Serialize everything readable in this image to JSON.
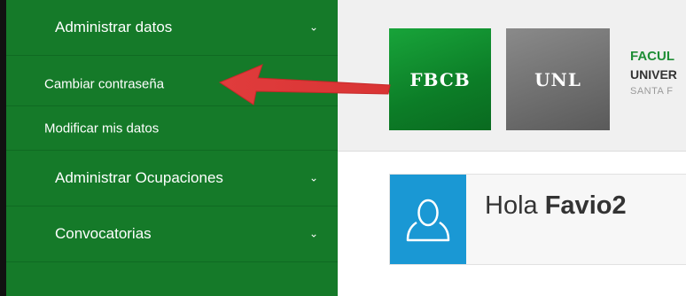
{
  "sidebar": {
    "menu": [
      {
        "label": "Administrar datos"
      },
      {
        "label": "Administrar Ocupaciones"
      },
      {
        "label": "Convocatorias"
      }
    ],
    "submenu": [
      {
        "label": "Cambiar contraseña"
      },
      {
        "label": "Modificar mis datos"
      }
    ],
    "chevron": "⌄"
  },
  "header": {
    "logo_fbcb": "FBCB",
    "logo_unl": "UNL",
    "institution_line1": "FACUL",
    "institution_line2": "UNIVER",
    "institution_line3": "SANTA F"
  },
  "welcome": {
    "greeting": "Hola",
    "username": "Favio2"
  },
  "colors": {
    "sidebar": "#157a29",
    "fbcb_green": "#12913a",
    "unl_gray": "#6d6d6d",
    "avatar_blue": "#1a98d4",
    "arrow_red": "#e03c3c"
  },
  "icons": {
    "chevron": "chevron-down-icon",
    "avatar": "user-icon",
    "annotation": "red-arrow-annotation"
  }
}
